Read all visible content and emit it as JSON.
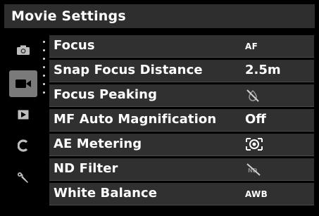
{
  "screen": {
    "title": "Movie Settings"
  },
  "sidebar": {
    "tabs": [
      {
        "icon": "camera-icon"
      },
      {
        "icon": "video-camera-icon",
        "active": true
      },
      {
        "icon": "playback-icon"
      },
      {
        "icon": "custom-c-icon"
      },
      {
        "icon": "wrench-icon"
      }
    ]
  },
  "menu": {
    "items": [
      {
        "label": "Focus",
        "value": "AF"
      },
      {
        "label": "Snap Focus Distance",
        "value": "2.5m"
      },
      {
        "label": "Focus Peaking",
        "value_icon": "peaking-off-icon"
      },
      {
        "label": "MF Auto Magnification",
        "value": "Off"
      },
      {
        "label": "AE Metering",
        "value_icon": "multi-segment-metering-icon"
      },
      {
        "label": "ND Filter",
        "value_icon": "nd-off-icon"
      },
      {
        "label": "White Balance",
        "value": "AWB"
      }
    ]
  },
  "colors": {
    "background": "#000000",
    "title_bar": "#2e2e2e",
    "row": "#303030",
    "active_tab": "#7a7a7a",
    "text": "#ffffff"
  }
}
